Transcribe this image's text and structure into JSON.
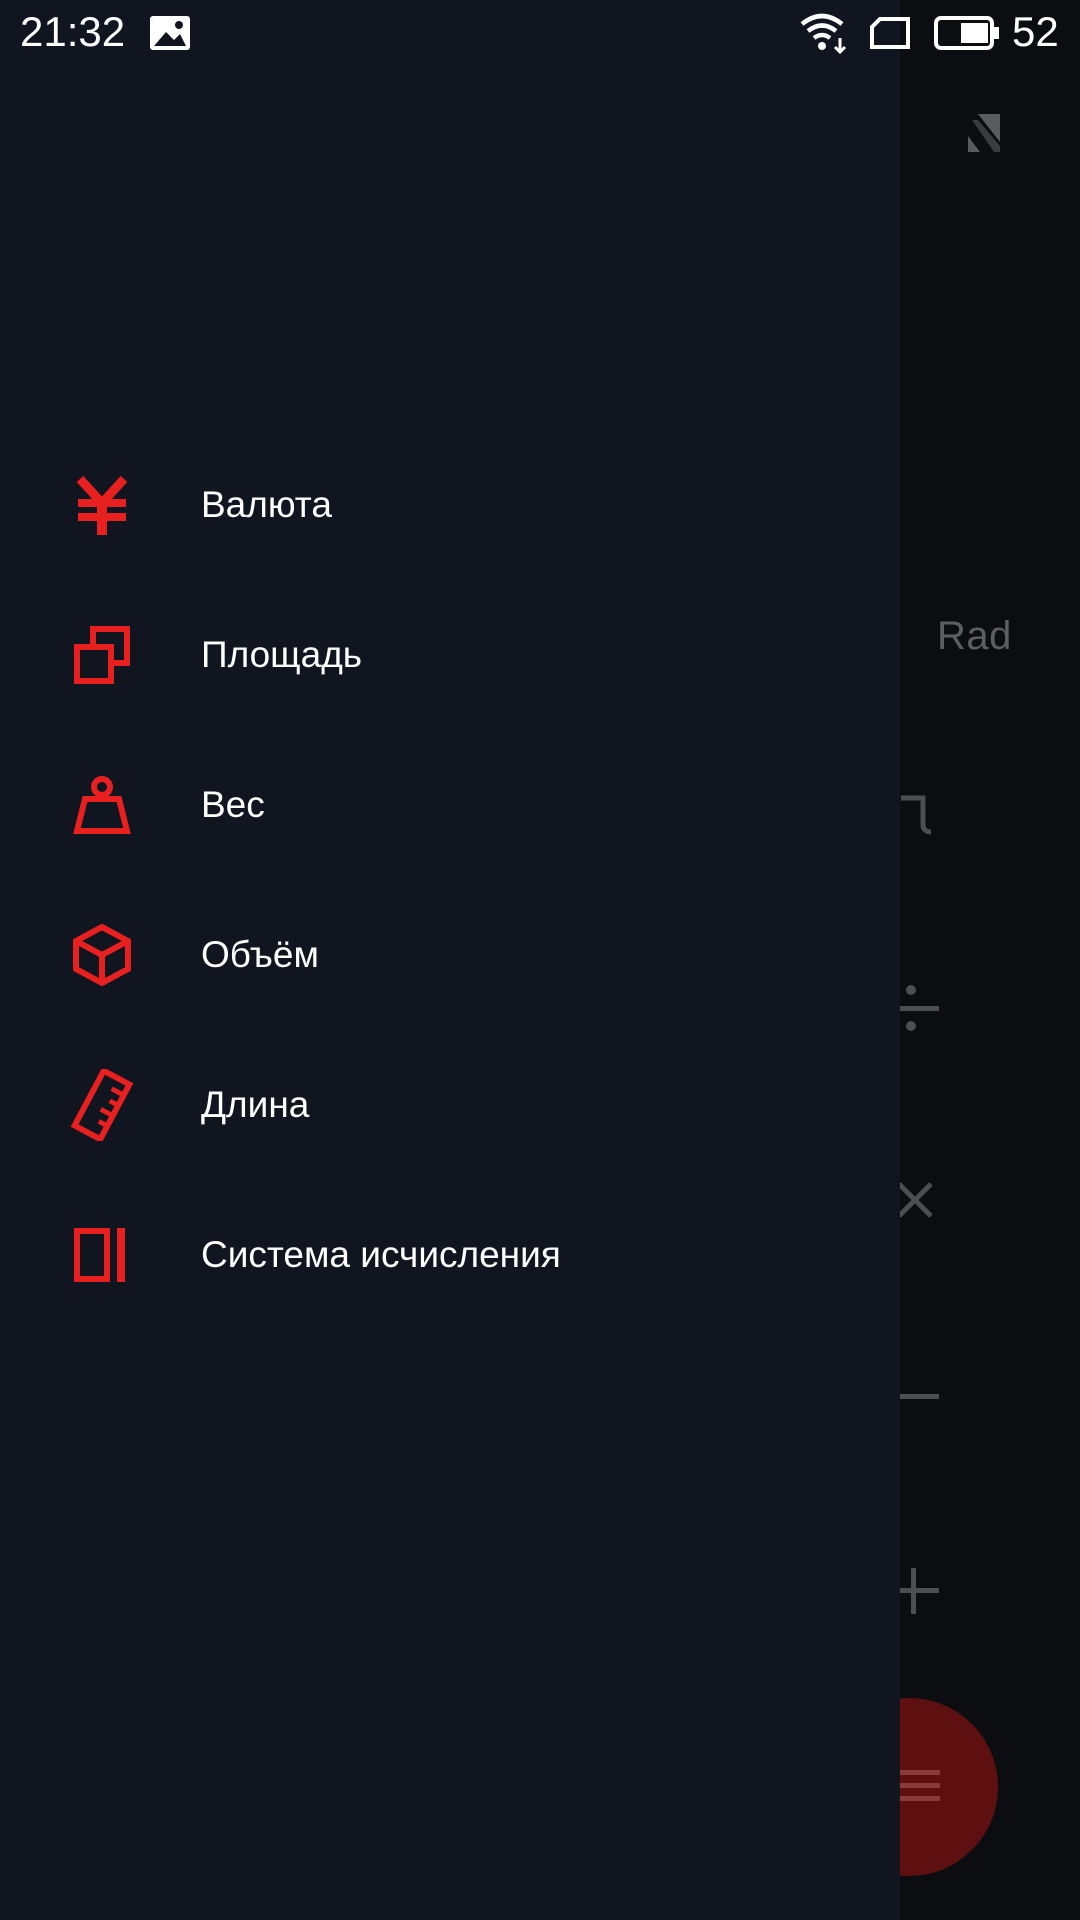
{
  "status_bar": {
    "time": "21:32",
    "battery": "52",
    "icons": [
      "image-notification-icon",
      "wifi-icon",
      "sim-card-icon",
      "battery-icon"
    ]
  },
  "background": {
    "mode_label": "Rad",
    "operators": [
      "ˆ",
      "÷",
      "×",
      "−",
      "+"
    ],
    "fab_icon": "menu-icon"
  },
  "drawer": {
    "items": [
      {
        "label": "Валюта",
        "icon": "yen-currency-icon"
      },
      {
        "label": "Площадь",
        "icon": "area-squares-icon"
      },
      {
        "label": "Вес",
        "icon": "weight-icon"
      },
      {
        "label": "Объём",
        "icon": "cube-volume-icon"
      },
      {
        "label": "Длина",
        "icon": "ruler-icon"
      },
      {
        "label": "Система исчисления",
        "icon": "number-system-icon"
      }
    ]
  },
  "colors": {
    "accent": "#e8201f",
    "drawer_bg": "#111520",
    "text": "#ffffff"
  }
}
